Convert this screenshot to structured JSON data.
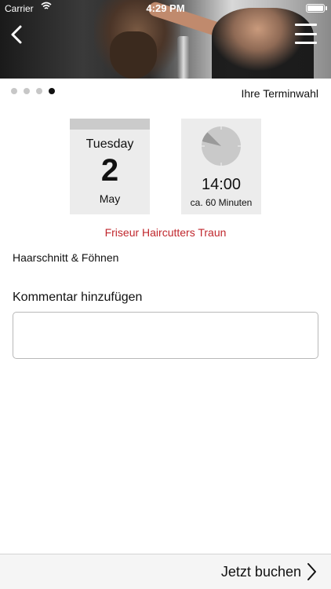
{
  "status_bar": {
    "carrier": "Carrier",
    "time": "4:29 PM"
  },
  "header": {
    "back_icon": "chevron-left-icon",
    "menu_icon": "hamburger-menu-icon"
  },
  "steps": {
    "total": 4,
    "current": 4,
    "title": "Ihre Terminwahl"
  },
  "date_card": {
    "weekday": "Tuesday",
    "day": "2",
    "month": "May"
  },
  "time_card": {
    "time": "14:00",
    "duration": "ca. 60 Minuten",
    "clock_icon": "clock-icon"
  },
  "salon": {
    "name": "Friseur Haircutters Traun",
    "color": "#c0272d"
  },
  "service": {
    "name": "Haarschnitt & Föhnen"
  },
  "comment": {
    "label": "Kommentar hinzufügen",
    "value": "",
    "placeholder": ""
  },
  "footer": {
    "book_label": "Jetzt buchen",
    "chevron_icon": "chevron-right-icon"
  }
}
